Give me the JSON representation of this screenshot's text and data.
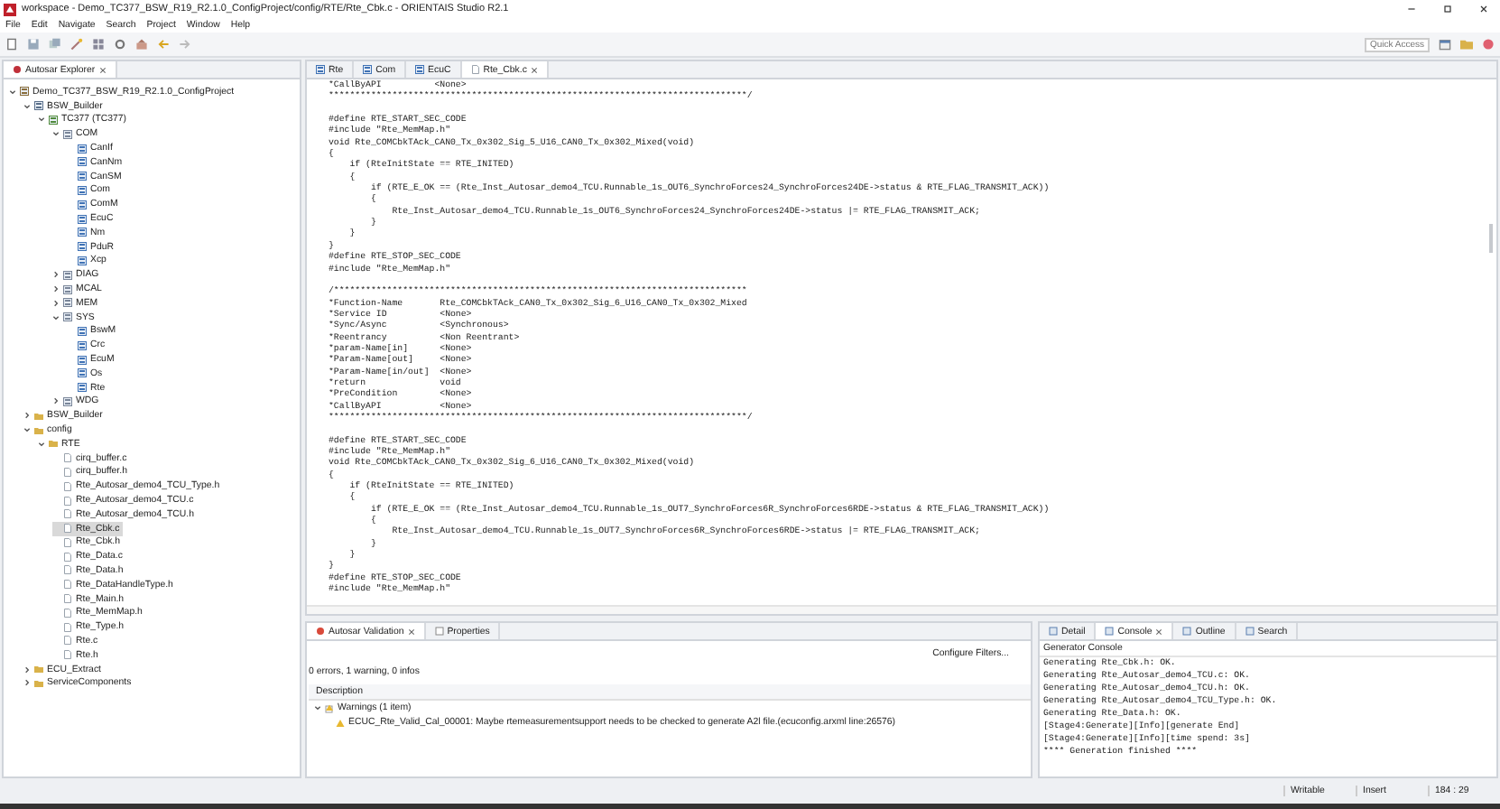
{
  "window": {
    "title": "workspace - Demo_TC377_BSW_R19_R2.1.0_ConfigProject/config/RTE/Rte_Cbk.c - ORIENTAIS Studio R2.1"
  },
  "menu": [
    "File",
    "Edit",
    "Navigate",
    "Search",
    "Project",
    "Window",
    "Help"
  ],
  "quick_access": {
    "placeholder": "Quick Access"
  },
  "explorer": {
    "title": "Autosar Explorer",
    "tree": [
      {
        "label": "Demo_TC377_BSW_R19_R2.1.0_ConfigProject",
        "kind": "project",
        "expanded": true,
        "selected": false,
        "children": [
          {
            "label": "BSW_Builder",
            "kind": "builder",
            "expanded": true,
            "selected": false,
            "children": [
              {
                "label": "TC377 (TC377)",
                "kind": "ecu",
                "expanded": true,
                "selected": false,
                "children": [
                  {
                    "label": "COM",
                    "kind": "category",
                    "expanded": true,
                    "selected": false,
                    "children": [
                      {
                        "label": "CanIf",
                        "kind": "module",
                        "selected": false
                      },
                      {
                        "label": "CanNm",
                        "kind": "module",
                        "selected": false
                      },
                      {
                        "label": "CanSM",
                        "kind": "module",
                        "selected": false
                      },
                      {
                        "label": "Com",
                        "kind": "module",
                        "selected": false
                      },
                      {
                        "label": "ComM",
                        "kind": "module",
                        "selected": false
                      },
                      {
                        "label": "EcuC",
                        "kind": "module",
                        "selected": false
                      },
                      {
                        "label": "Nm",
                        "kind": "module",
                        "selected": false
                      },
                      {
                        "label": "PduR",
                        "kind": "module",
                        "selected": false
                      },
                      {
                        "label": "Xcp",
                        "kind": "module",
                        "selected": false
                      }
                    ]
                  },
                  {
                    "label": "DIAG",
                    "kind": "category",
                    "expanded": false,
                    "selected": false
                  },
                  {
                    "label": "MCAL",
                    "kind": "category",
                    "expanded": false,
                    "selected": false
                  },
                  {
                    "label": "MEM",
                    "kind": "category",
                    "expanded": false,
                    "selected": false
                  },
                  {
                    "label": "SYS",
                    "kind": "category",
                    "expanded": true,
                    "selected": false,
                    "children": [
                      {
                        "label": "BswM",
                        "kind": "module",
                        "selected": false
                      },
                      {
                        "label": "Crc",
                        "kind": "module",
                        "selected": false
                      },
                      {
                        "label": "EcuM",
                        "kind": "module",
                        "selected": false
                      },
                      {
                        "label": "Os",
                        "kind": "module",
                        "selected": false
                      },
                      {
                        "label": "Rte",
                        "kind": "module",
                        "selected": false
                      }
                    ]
                  },
                  {
                    "label": "WDG",
                    "kind": "category",
                    "expanded": false,
                    "selected": false
                  }
                ]
              }
            ]
          },
          {
            "label": "BSW_Builder",
            "kind": "folder",
            "expanded": false,
            "selected": false
          },
          {
            "label": "config",
            "kind": "folder",
            "expanded": true,
            "selected": false,
            "children": [
              {
                "label": "RTE",
                "kind": "folder",
                "expanded": true,
                "selected": false,
                "children": [
                  {
                    "label": "cirq_buffer.c",
                    "kind": "file",
                    "selected": false
                  },
                  {
                    "label": "cirq_buffer.h",
                    "kind": "file",
                    "selected": false
                  },
                  {
                    "label": "Rte_Autosar_demo4_TCU_Type.h",
                    "kind": "file",
                    "selected": false
                  },
                  {
                    "label": "Rte_Autosar_demo4_TCU.c",
                    "kind": "file",
                    "selected": false
                  },
                  {
                    "label": "Rte_Autosar_demo4_TCU.h",
                    "kind": "file",
                    "selected": false
                  },
                  {
                    "label": "Rte_Cbk.c",
                    "kind": "file",
                    "selected": true
                  },
                  {
                    "label": "Rte_Cbk.h",
                    "kind": "file",
                    "selected": false
                  },
                  {
                    "label": "Rte_Data.c",
                    "kind": "file",
                    "selected": false
                  },
                  {
                    "label": "Rte_Data.h",
                    "kind": "file",
                    "selected": false
                  },
                  {
                    "label": "Rte_DataHandleType.h",
                    "kind": "file",
                    "selected": false
                  },
                  {
                    "label": "Rte_Main.h",
                    "kind": "file",
                    "selected": false
                  },
                  {
                    "label": "Rte_MemMap.h",
                    "kind": "file",
                    "selected": false
                  },
                  {
                    "label": "Rte_Type.h",
                    "kind": "file",
                    "selected": false
                  },
                  {
                    "label": "Rte.c",
                    "kind": "file",
                    "selected": false
                  },
                  {
                    "label": "Rte.h",
                    "kind": "file",
                    "selected": false
                  }
                ]
              }
            ]
          },
          {
            "label": "ECU_Extract",
            "kind": "folder",
            "expanded": false,
            "selected": false
          },
          {
            "label": "ServiceComponents",
            "kind": "folder",
            "expanded": false,
            "selected": false
          }
        ]
      }
    ]
  },
  "editor": {
    "tabs": [
      {
        "label": "Rte",
        "kind": "module",
        "selected": false
      },
      {
        "label": "Com",
        "kind": "module",
        "selected": false
      },
      {
        "label": "EcuC",
        "kind": "module",
        "selected": false
      },
      {
        "label": "Rte_Cbk.c",
        "kind": "file",
        "selected": true
      }
    ],
    "lines": [
      {
        "kind": "code",
        "text": "*CallByAPI          <None>"
      },
      {
        "kind": "code",
        "text": "*******************************************************************************/"
      },
      {
        "kind": "blank"
      },
      {
        "kind": "code",
        "text": "#define RTE_START_SEC_CODE"
      },
      {
        "kind": "code",
        "text": "#include \"Rte_MemMap.h\""
      },
      {
        "kind": "code",
        "text": "void Rte_COMCbkTAck_CAN0_Tx_0x302_Sig_5_U16_CAN0_Tx_0x302_Mixed(void)"
      },
      {
        "kind": "code",
        "text": "{"
      },
      {
        "kind": "code",
        "text": "    if (RteInitState == RTE_INITED)"
      },
      {
        "kind": "code",
        "text": "    {"
      },
      {
        "kind": "code",
        "text": "        if (RTE_E_OK == (Rte_Inst_Autosar_demo4_TCU.Runnable_1s_OUT6_SynchroForces24_SynchroForces24DE->status & RTE_FLAG_TRANSMIT_ACK))"
      },
      {
        "kind": "code",
        "text": "        {"
      },
      {
        "kind": "code",
        "text": "            Rte_Inst_Autosar_demo4_TCU.Runnable_1s_OUT6_SynchroForces24_SynchroForces24DE->status |= RTE_FLAG_TRANSMIT_ACK;"
      },
      {
        "kind": "code",
        "text": "        }"
      },
      {
        "kind": "code",
        "text": "    }"
      },
      {
        "kind": "code",
        "text": "}"
      },
      {
        "kind": "code",
        "text": "#define RTE_STOP_SEC_CODE"
      },
      {
        "kind": "code",
        "text": "#include \"Rte_MemMap.h\""
      },
      {
        "kind": "blank"
      },
      {
        "kind": "code",
        "text": "/******************************************************************************"
      },
      {
        "kind": "code",
        "text": "*Function-Name       Rte_COMCbkTAck_CAN0_Tx_0x302_Sig_6_U16_CAN0_Tx_0x302_Mixed"
      },
      {
        "kind": "code",
        "text": "*Service ID          <None>"
      },
      {
        "kind": "code",
        "text": "*Sync/Async          <Synchronous>"
      },
      {
        "kind": "code",
        "text": "*Reentrancy          <Non Reentrant>"
      },
      {
        "kind": "code",
        "text": "*param-Name[in]      <None>"
      },
      {
        "kind": "code",
        "text": "*Param-Name[out]     <None>"
      },
      {
        "kind": "code",
        "text": "*Param-Name[in/out]  <None>"
      },
      {
        "kind": "code",
        "text": "*return              void"
      },
      {
        "kind": "code",
        "text": "*PreCondition        <None>"
      },
      {
        "kind": "code",
        "text": "*CallByAPI           <None>"
      },
      {
        "kind": "code",
        "text": "*******************************************************************************/"
      },
      {
        "kind": "blank"
      },
      {
        "kind": "code",
        "text": "#define RTE_START_SEC_CODE"
      },
      {
        "kind": "code",
        "text": "#include \"Rte_MemMap.h\""
      },
      {
        "kind": "code",
        "text": "void Rte_COMCbkTAck_CAN0_Tx_0x302_Sig_6_U16_CAN0_Tx_0x302_Mixed(void)"
      },
      {
        "kind": "code",
        "text": "{"
      },
      {
        "kind": "code",
        "text": "    if (RteInitState == RTE_INITED)"
      },
      {
        "kind": "code",
        "text": "    {"
      },
      {
        "kind": "code",
        "text": "        if (RTE_E_OK == (Rte_Inst_Autosar_demo4_TCU.Runnable_1s_OUT7_SynchroForces6R_SynchroForces6RDE->status & RTE_FLAG_TRANSMIT_ACK))"
      },
      {
        "kind": "code",
        "text": "        {"
      },
      {
        "kind": "code",
        "text": "            Rte_Inst_Autosar_demo4_TCU.Runnable_1s_OUT7_SynchroForces6R_SynchroForces6RDE->status |= RTE_FLAG_TRANSMIT_ACK;"
      },
      {
        "kind": "code",
        "text": "        }"
      },
      {
        "kind": "code",
        "text": "    }"
      },
      {
        "kind": "code",
        "text": "}"
      },
      {
        "kind": "code",
        "text": "#define RTE_STOP_SEC_CODE"
      },
      {
        "kind": "code",
        "text": "#include \"Rte_MemMap.h\""
      }
    ]
  },
  "validation": {
    "tabs": [
      {
        "label": "Autosar Validation",
        "selected": true
      },
      {
        "label": "Properties",
        "selected": false
      }
    ],
    "configure_filters": "Configure Filters...",
    "summary": "0 errors, 1 warning, 0 infos",
    "column": "Description",
    "groups": [
      {
        "label": "Warnings (1 item)",
        "expanded": true,
        "items": [
          "ECUC_Rte_Valid_Cal_00001: Maybe rtemeasurementsupport needs to be checked to generate A2l file.(ecuconfig.arxml line:26576)"
        ]
      }
    ]
  },
  "console": {
    "tabs": [
      {
        "label": "Detail",
        "selected": false
      },
      {
        "label": "Console",
        "selected": true
      },
      {
        "label": "Outline",
        "selected": false
      },
      {
        "label": "Search",
        "selected": false
      }
    ],
    "title": "Generator Console",
    "lines": [
      "Generating Rte_Cbk.h: OK.",
      "Generating Rte_Autosar_demo4_TCU.c: OK.",
      "Generating Rte_Autosar_demo4_TCU.h: OK.",
      "Generating Rte_Autosar_demo4_TCU_Type.h: OK.",
      "Generating Rte_Data.h: OK.",
      "[Stage4:Generate][Info][generate End]",
      "[Stage4:Generate][Info][time spend: 3s]",
      "**** Generation finished ****"
    ]
  },
  "status_bar": [
    "Writable",
    "Insert",
    "184 : 29"
  ]
}
